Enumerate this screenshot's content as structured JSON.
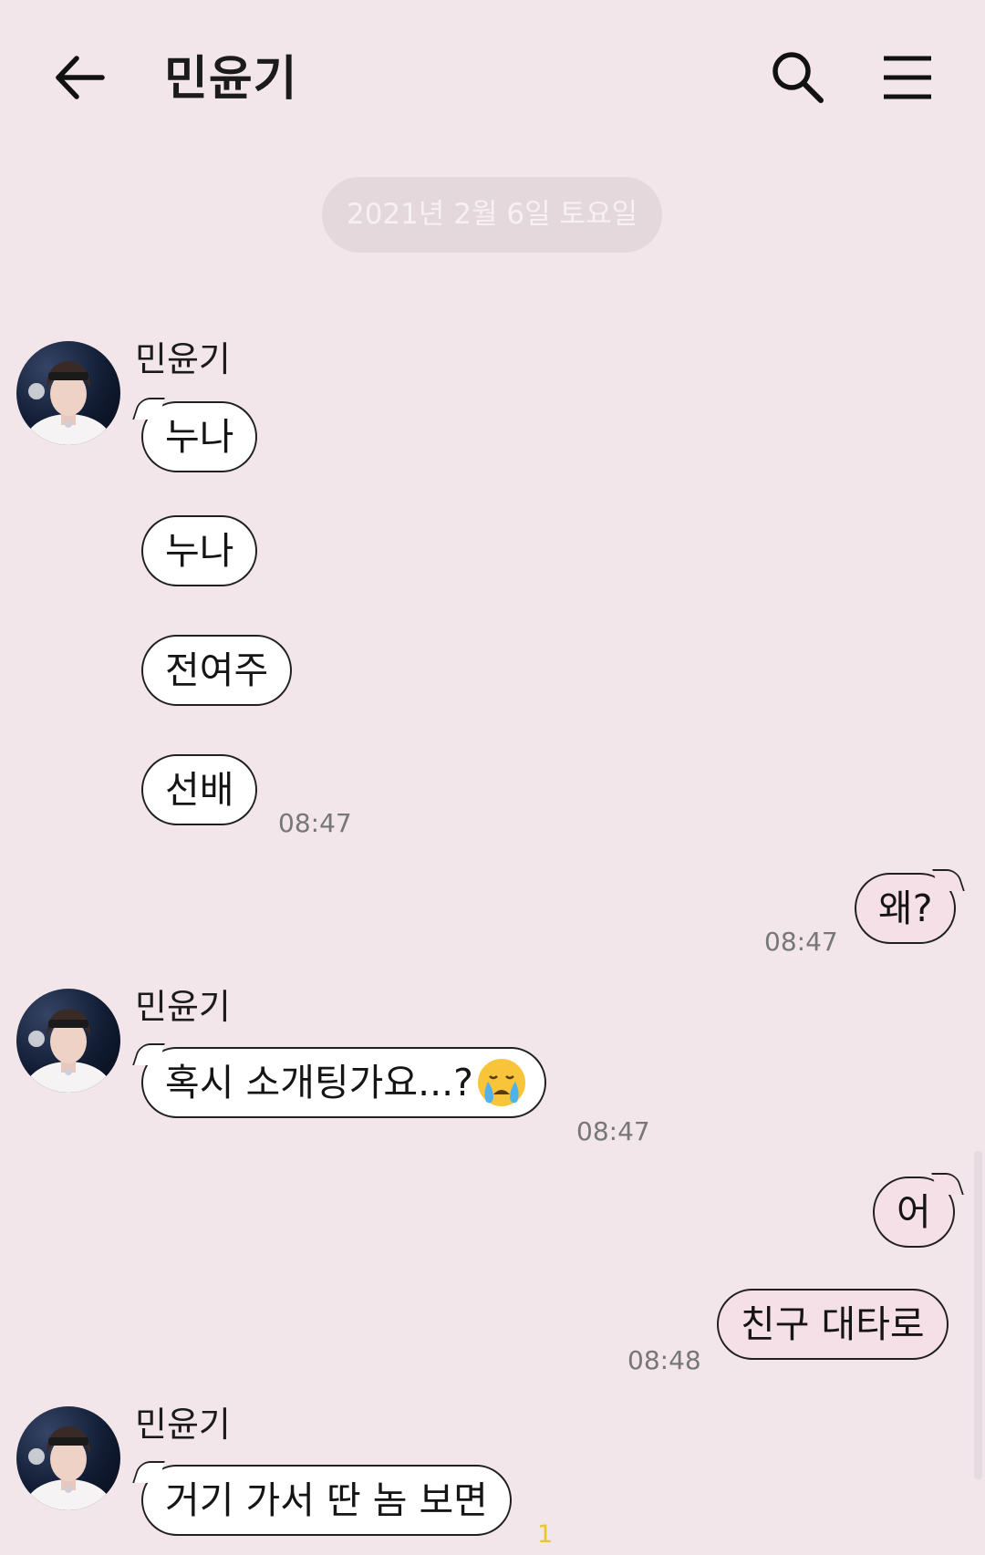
{
  "header": {
    "title": "민윤기",
    "back_icon": "arrow-left-icon",
    "search_icon": "search-icon",
    "menu_icon": "hamburger-menu-icon"
  },
  "date_separator": "2021년 2월 6일 토요일",
  "messages": [
    {
      "sender": "민윤기",
      "text": "누나",
      "side": "left"
    },
    {
      "sender": "민윤기",
      "text": "누나",
      "side": "left"
    },
    {
      "sender": "민윤기",
      "text": "전여주",
      "side": "left"
    },
    {
      "sender": "민윤기",
      "text": "선배",
      "side": "left",
      "time": "08:47"
    },
    {
      "sender": "me",
      "text": "왜?",
      "side": "right",
      "time": "08:47"
    },
    {
      "sender": "민윤기",
      "text": "혹시 소개팅가요...?",
      "emoji": "crying-face-emoji",
      "side": "left",
      "time": "08:47"
    },
    {
      "sender": "me",
      "text": "어",
      "side": "right"
    },
    {
      "sender": "me",
      "text": "친구 대타로",
      "side": "right",
      "time": "08:48"
    },
    {
      "sender": "민윤기",
      "text": "거기 가서 딴 놈 보면",
      "side": "left",
      "unread": "1"
    }
  ],
  "colors": {
    "background": "#f2e6ea",
    "my_bubble": "#f4e0e6",
    "their_bubble": "#ffffff",
    "unread_count": "#e8c728"
  }
}
